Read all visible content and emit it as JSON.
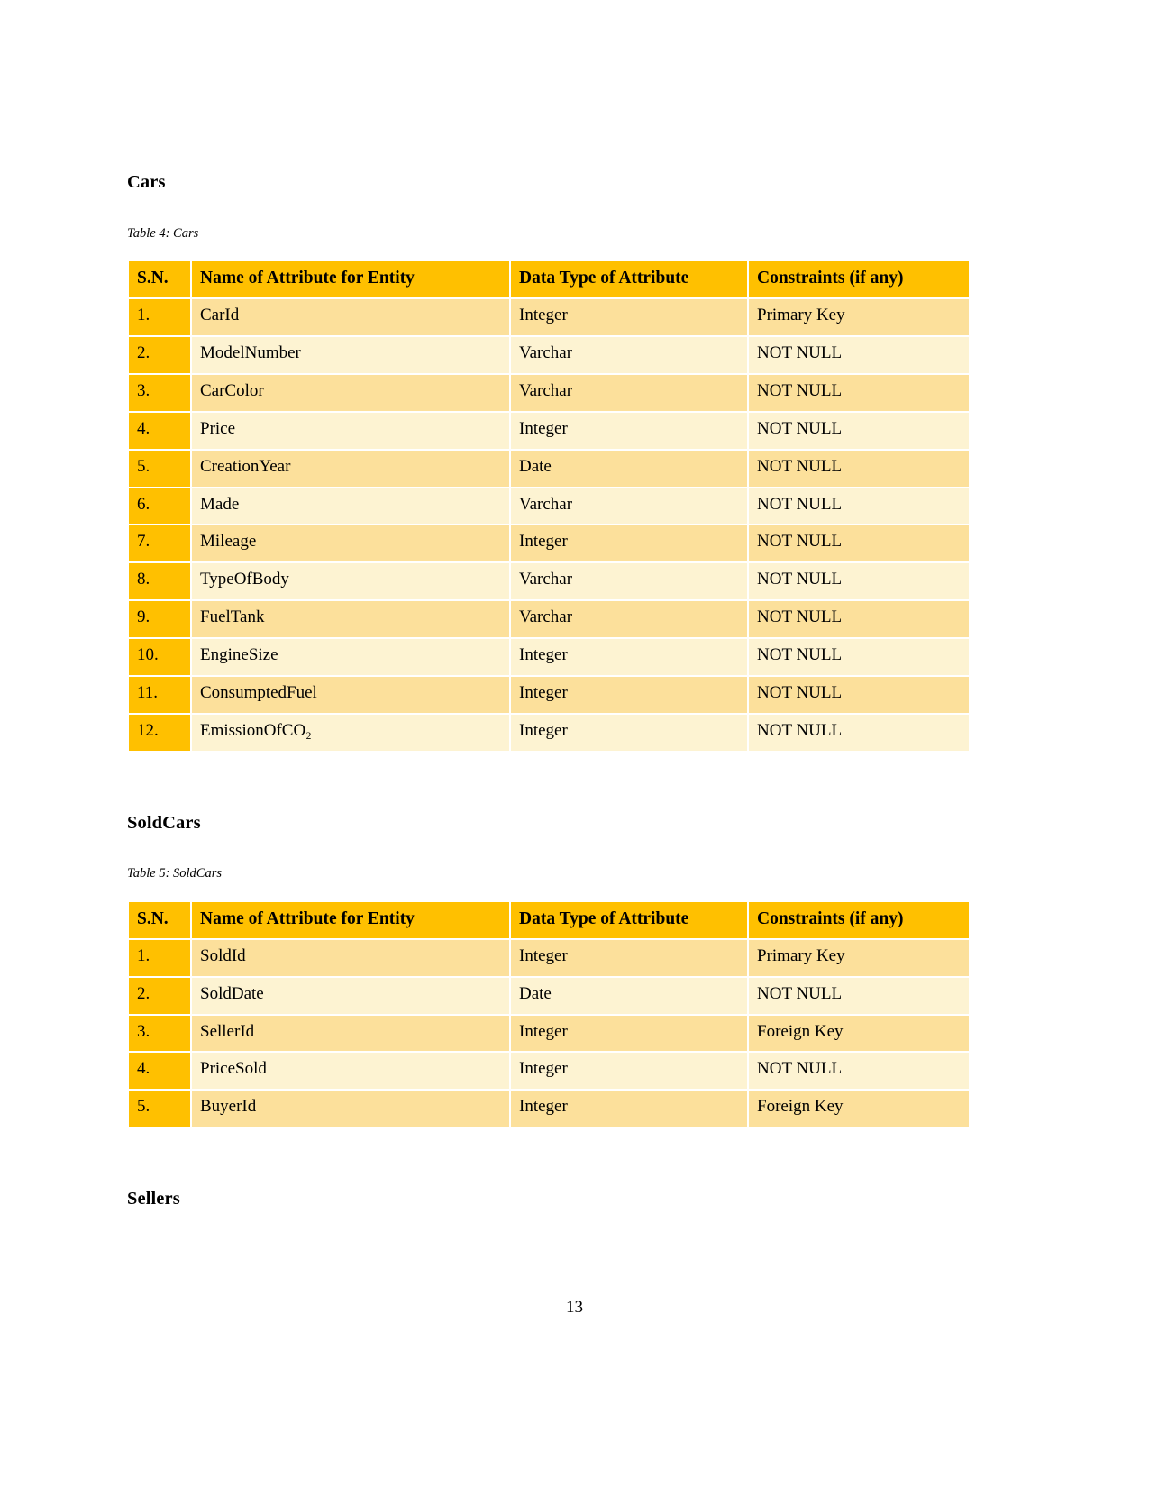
{
  "document": {
    "page_number": "13",
    "colors": {
      "header_bg": "#FFC000",
      "sn_bg": "#FFC000",
      "row_odd_bg": "#FCE09B",
      "row_even_bg": "#FDF3D2",
      "text": "#000000"
    }
  },
  "columns": {
    "sn": "S.N.",
    "name": "Name of Attribute for Entity",
    "type": "Data Type of Attribute",
    "constraints": "Constraints (if any)"
  },
  "sections": [
    {
      "heading": "Cars",
      "caption": "Table 4: Cars",
      "rows": [
        {
          "sn": "1.",
          "name": "CarId",
          "type": "Integer",
          "constraints": "Primary Key"
        },
        {
          "sn": "2.",
          "name": "ModelNumber",
          "type": "Varchar",
          "constraints": "NOT NULL"
        },
        {
          "sn": "3.",
          "name": "CarColor",
          "type": "Varchar",
          "constraints": "NOT NULL"
        },
        {
          "sn": "4.",
          "name": "Price",
          "type": "Integer",
          "constraints": "NOT NULL"
        },
        {
          "sn": "5.",
          "name": "CreationYear",
          "type": "Date",
          "constraints": "NOT NULL"
        },
        {
          "sn": "6.",
          "name": "Made",
          "type": "Varchar",
          "constraints": "NOT NULL"
        },
        {
          "sn": "7.",
          "name": "Mileage",
          "type": "Integer",
          "constraints": "NOT NULL"
        },
        {
          "sn": "8.",
          "name": "TypeOfBody",
          "type": "Varchar",
          "constraints": "NOT NULL"
        },
        {
          "sn": "9.",
          "name": "FuelTank",
          "type": "Varchar",
          "constraints": "NOT NULL"
        },
        {
          "sn": "10.",
          "name": "EngineSize",
          "type": "Integer",
          "constraints": "NOT NULL"
        },
        {
          "sn": "11.",
          "name": "ConsumptedFuel",
          "type": "Integer",
          "constraints": "NOT NULL"
        },
        {
          "sn": "12.",
          "name": "EmissionOfCO₂",
          "type": "Integer",
          "constraints": "NOT NULL"
        }
      ]
    },
    {
      "heading": "SoldCars",
      "caption": "Table 5: SoldCars",
      "rows": [
        {
          "sn": "1.",
          "name": "SoldId",
          "type": "Integer",
          "constraints": "Primary Key"
        },
        {
          "sn": "2.",
          "name": "SoldDate",
          "type": "Date",
          "constraints": "NOT NULL"
        },
        {
          "sn": "3.",
          "name": "SellerId",
          "type": "Integer",
          "constraints": "Foreign Key"
        },
        {
          "sn": "4.",
          "name": "PriceSold",
          "type": "Integer",
          "constraints": "NOT NULL"
        },
        {
          "sn": "5.",
          "name": "BuyerId",
          "type": "Integer",
          "constraints": "Foreign Key"
        }
      ]
    },
    {
      "heading": "Sellers",
      "caption": null,
      "rows": []
    }
  ]
}
